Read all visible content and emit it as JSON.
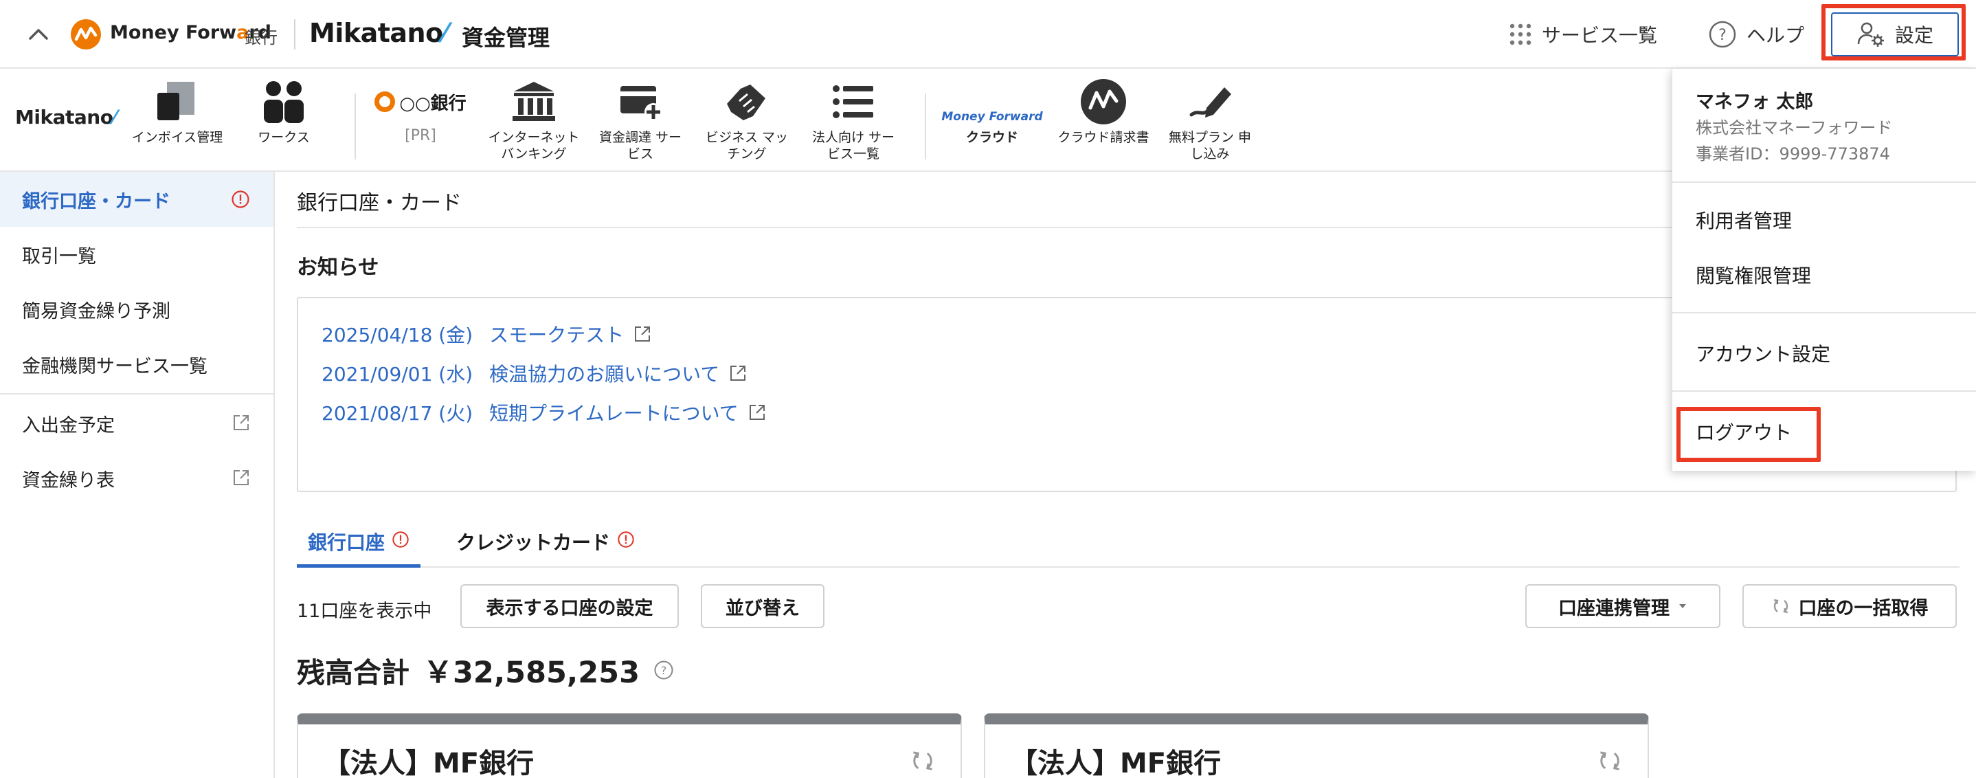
{
  "header": {
    "brand_part1": "Money Forw",
    "brand_part2": "a",
    "brand_part3": "rd",
    "brand_sub": "銀行",
    "app_name": "Mikatano",
    "app_title": "資金管理",
    "services_label": "サービス一覧",
    "help_label": "ヘルプ",
    "settings_label": "設定"
  },
  "service_bar": {
    "logo": "Mikatano",
    "items": [
      {
        "label": "インボイス管理",
        "icon": "invoice-icon"
      },
      {
        "label": "ワークス",
        "icon": "works-icon"
      },
      {
        "label": "○○銀行",
        "sub": "[PR]",
        "icon": "bank-ring-icon"
      },
      {
        "label": "インターネット\nバンキング",
        "icon": "bank-building-icon"
      },
      {
        "label": "資金調達 サー\nビス",
        "icon": "funding-icon"
      },
      {
        "label": "ビジネス マッ\nチング",
        "icon": "handshake-icon"
      },
      {
        "label": "法人向け サー\nビス一覧",
        "icon": "list-icon"
      },
      {
        "label": "クラウド",
        "brand": "Money Forward",
        "icon": "mf-cloud-logo"
      },
      {
        "label": "クラウド請求書",
        "icon": "cloud-invoice-icon"
      },
      {
        "label": "無料プラン 申\nし込み",
        "icon": "signup-pen-icon"
      }
    ]
  },
  "sidebar": {
    "items": [
      {
        "label": "銀行口座・カード",
        "active": true,
        "alert": true
      },
      {
        "label": "取引一覧"
      },
      {
        "label": "簡易資金繰り予測"
      },
      {
        "label": "金融機関サービス一覧"
      },
      {
        "label": "入出金予定",
        "external": true
      },
      {
        "label": "資金繰り表",
        "external": true
      }
    ]
  },
  "main": {
    "title": "銀行口座・カード",
    "notice_heading": "お知らせ",
    "news": [
      {
        "date": "2025/04/18 (金)",
        "text": "スモークテスト"
      },
      {
        "date": "2021/09/01 (水)",
        "text": "検温協力のお願いについて"
      },
      {
        "date": "2021/08/17 (火)",
        "text": "短期プライムレートについて"
      }
    ],
    "tabs": [
      {
        "label": "銀行口座",
        "active": true
      },
      {
        "label": "クレジットカード",
        "active": false
      }
    ],
    "account_count": "11口座を表示中",
    "btn_display_settings": "表示する口座の設定",
    "btn_sort": "並び替え",
    "btn_link_manage": "口座連携管理",
    "btn_bulk_fetch": "口座の一括取得",
    "balance_label": "残高合計",
    "balance_amount": "￥32,585,253",
    "cards": [
      {
        "name": "【法人】MF銀行"
      },
      {
        "name": "【法人】MF銀行"
      }
    ]
  },
  "dropdown": {
    "user_name": "マネフォ 太郎",
    "company": "株式会社マネーフォワード",
    "business_id": "事業者ID：9999-773874",
    "items": [
      "利用者管理",
      "閲覧権限管理",
      "アカウント設定",
      "ログアウト"
    ]
  },
  "colors": {
    "accent_blue": "#2d69c4",
    "brand_orange": "#ee7800",
    "highlight_red": "#ea3a24",
    "card_header_gray": "#7b7e82"
  }
}
